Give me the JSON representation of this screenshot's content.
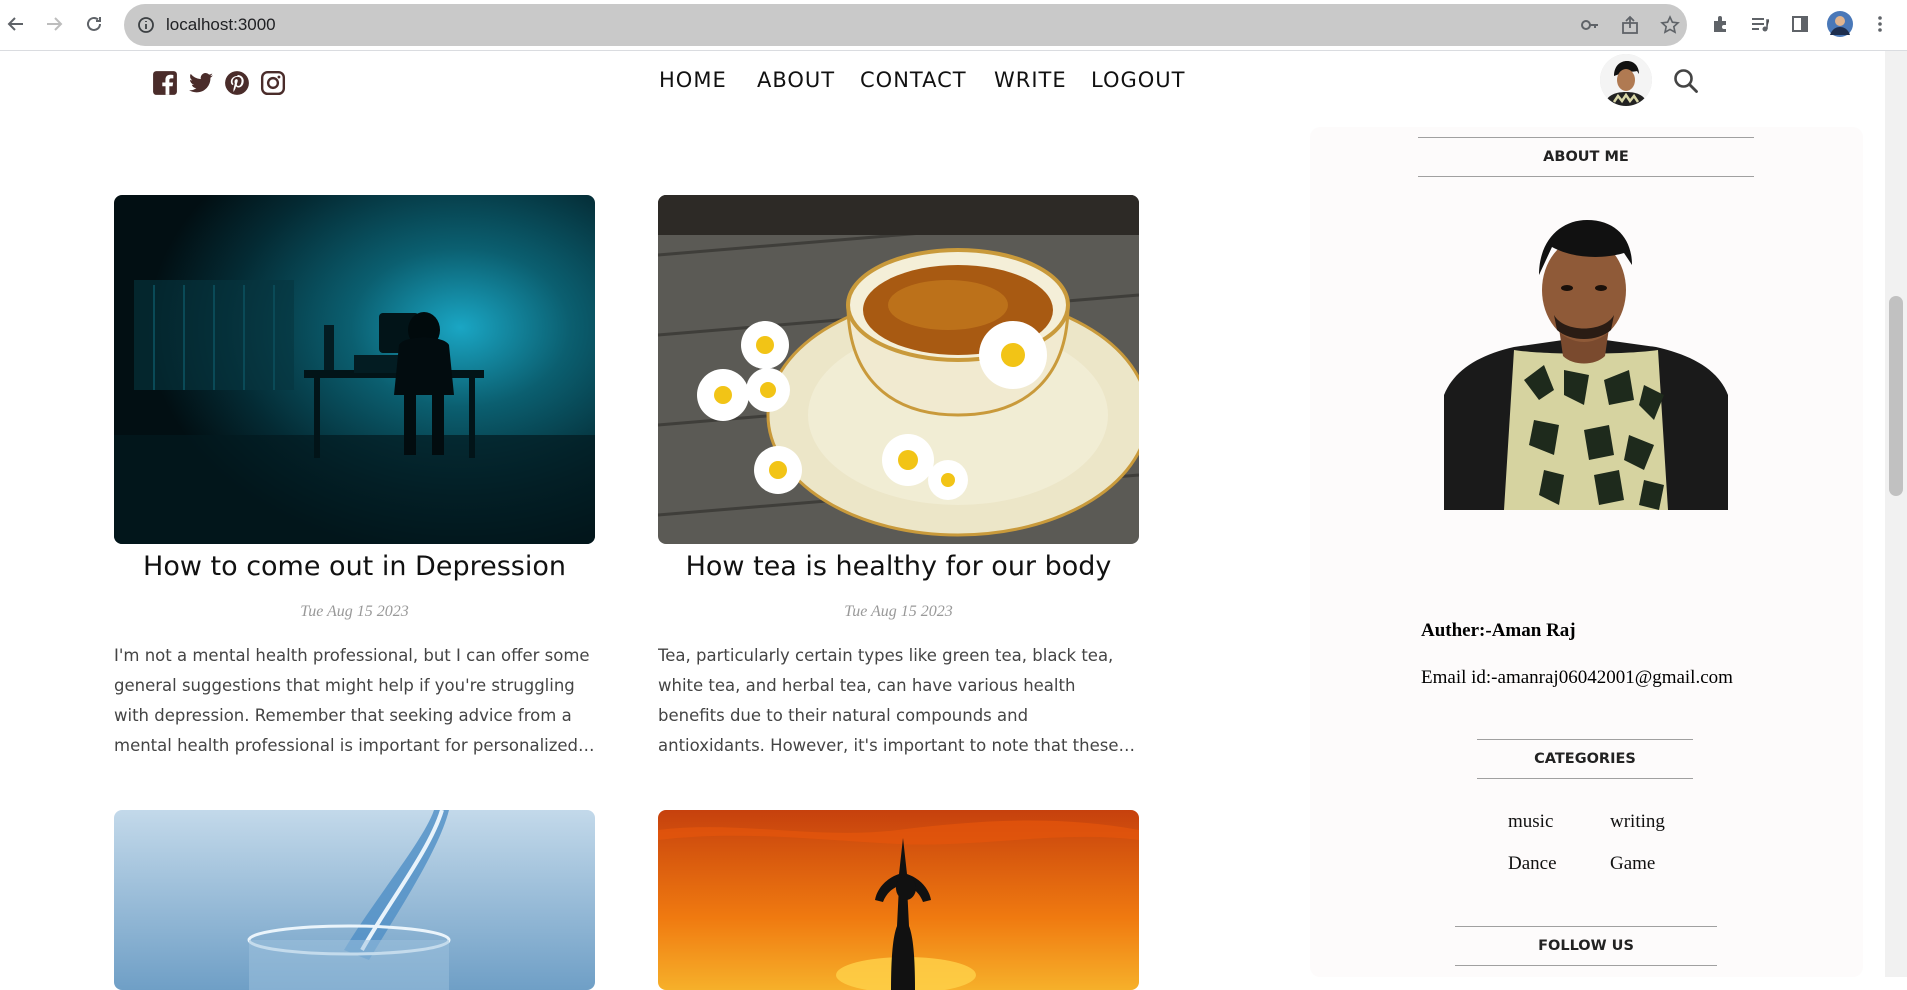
{
  "browser": {
    "url": "localhost:3000",
    "icons": [
      "back-icon",
      "forward-icon",
      "reload-icon",
      "site-info-icon",
      "key-icon",
      "share-icon",
      "bookmark-star-icon",
      "extensions-icon",
      "media-queue-icon",
      "sidebar-icon",
      "profile-avatar",
      "menu-icon"
    ]
  },
  "header": {
    "social_icons": [
      "facebook-icon",
      "twitter-icon",
      "pinterest-icon",
      "instagram-icon"
    ],
    "nav": [
      "HOME",
      "ABOUT",
      "CONTACT",
      "WRITE",
      "LOGOUT"
    ]
  },
  "posts": [
    {
      "title": "How to come out in Depression",
      "date": "Tue Aug 15 2023",
      "desc": "I'm not a mental health professional, but I can offer some general suggestions that might help if you're struggling with depression. Remember that seeking advice from a mental health professional is important for personalized guidance."
    },
    {
      "title": "How tea is healthy for our body",
      "date": "Tue Aug 15 2023",
      "desc": "Tea, particularly certain types like green tea, black tea, white tea, and herbal tea, can have various health benefits due to their natural compounds and antioxidants. However, it's important to note that these effects may vary."
    }
  ],
  "sidebar": {
    "about_title": "ABOUT ME",
    "author": "Auther:-Aman Raj",
    "email": "Email id:-amanraj06042001@gmail.com",
    "categories_title": "CATEGORIES",
    "categories": [
      "music",
      "writing",
      "Dance",
      "Game"
    ],
    "follow_title": "FOLLOW US"
  },
  "colors": {
    "accent": "#4a2c2a",
    "sidebar_bg": "#fdfbfb"
  }
}
